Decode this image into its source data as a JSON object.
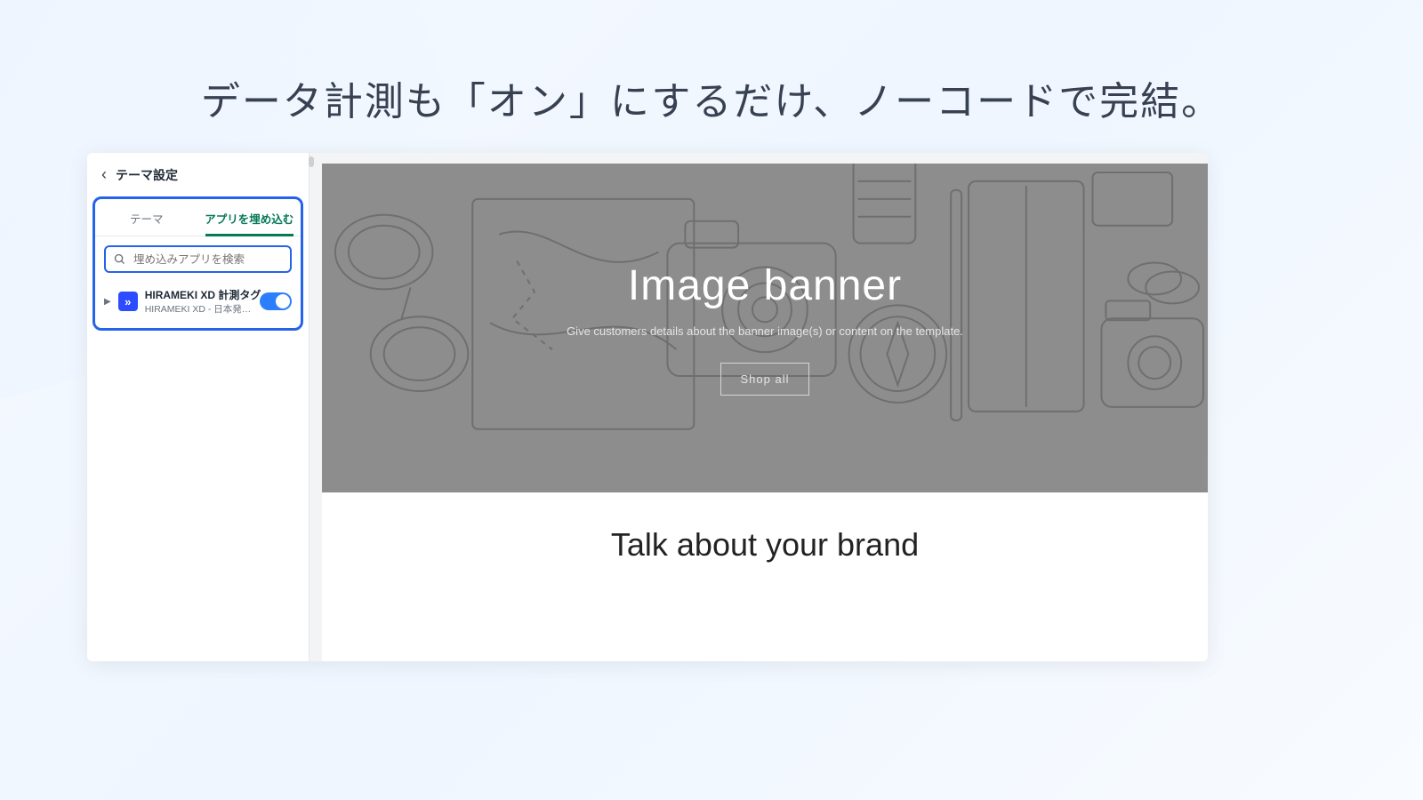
{
  "headline": "データ計測も「オン」にするだけ、ノーコードで完結。",
  "sidebar": {
    "back_aria": "back",
    "title": "テーマ設定",
    "tabs": {
      "theme": "テーマ",
      "embed": "アプリを埋め込む"
    },
    "search_placeholder": "埋め込みアプリを検索",
    "app": {
      "name": "HIRAMEKI XD 計測タグ",
      "subtitle": "HIRAMEKI XD - 日本発のEコ...",
      "icon_glyph": "»",
      "toggle_on": true
    }
  },
  "preview": {
    "banner_title": "Image banner",
    "banner_subtitle": "Give customers details about the banner image(s) or content on the template.",
    "shop_button": "Shop all",
    "brand_heading": "Talk about your brand"
  }
}
